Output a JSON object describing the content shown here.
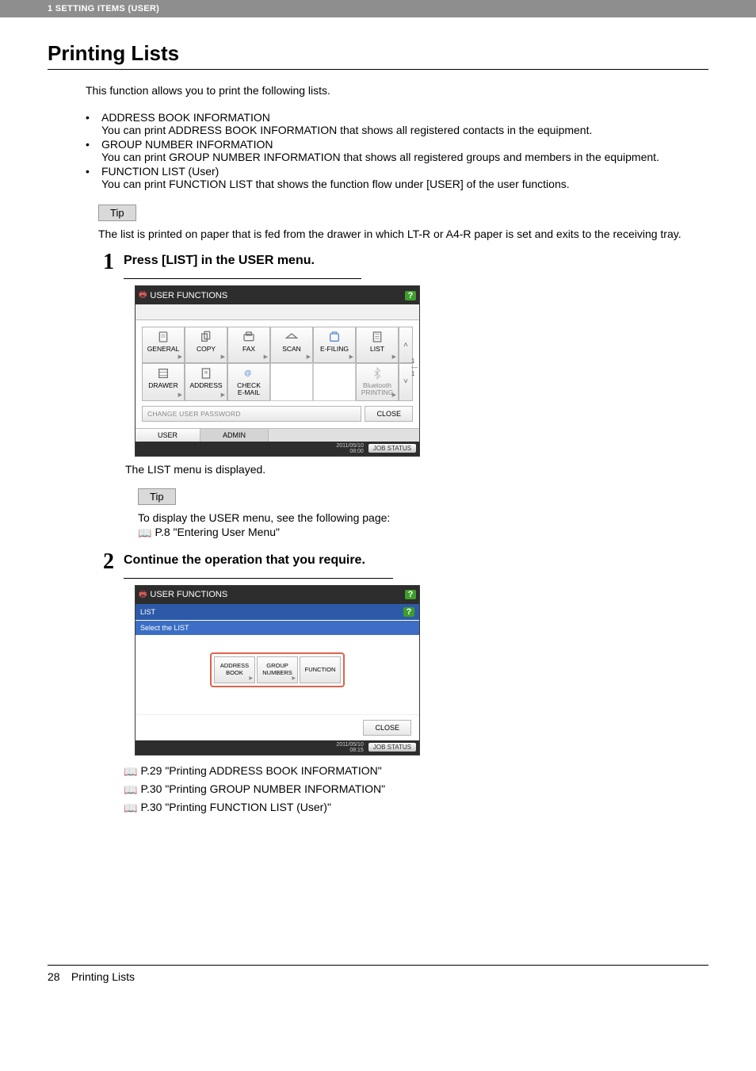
{
  "header": {
    "breadcrumb": "1 SETTING ITEMS (USER)"
  },
  "title": "Printing Lists",
  "intro": "This function allows you to print the following lists.",
  "bullets": [
    {
      "name": "ADDRESS BOOK INFORMATION",
      "desc": "You can print ADDRESS BOOK INFORMATION that shows all registered contacts in the equipment."
    },
    {
      "name": "GROUP NUMBER INFORMATION",
      "desc": "You can print GROUP NUMBER INFORMATION that shows all registered groups and members in the equipment."
    },
    {
      "name": "FUNCTION LIST (User)",
      "desc": "You can print FUNCTION LIST that shows the function flow under [USER] of the user functions."
    }
  ],
  "tip_label": "Tip",
  "tip1_text": "The list is printed on paper that is fed from the drawer in which LT-R or A4-R paper is set and exits to the receiving tray.",
  "step1": {
    "num": "1",
    "title": "Press [LIST] in the USER menu.",
    "after_text": "The LIST menu is displayed."
  },
  "panel1": {
    "title": "USER FUNCTIONS",
    "icons_row1": [
      "GENERAL",
      "COPY",
      "FAX",
      "SCAN",
      "E-FILING",
      "LIST"
    ],
    "icons_row2": [
      "DRAWER",
      "ADDRESS",
      "CHECK\nE-MAIL",
      "",
      "",
      "Bluetooth\nPRINTING"
    ],
    "change_pw": "CHANGE USER PASSWORD",
    "close": "CLOSE",
    "tabs": [
      "USER",
      "ADMIN"
    ],
    "datetime1": "2011/05/10",
    "datetime2": "08:00",
    "jobstatus": "JOB STATUS",
    "page_ind_num": "1",
    "page_ind_den": "1"
  },
  "tip2": {
    "text": "To display the USER menu, see the following page:",
    "ref": "P.8 \"Entering User Menu\""
  },
  "step2": {
    "num": "2",
    "title": "Continue the operation that you require."
  },
  "panel2": {
    "title": "USER FUNCTIONS",
    "sub1": "LIST",
    "sub2": "Select the LIST",
    "buttons": [
      {
        "l1": "ADDRESS",
        "l2": "BOOK"
      },
      {
        "l1": "GROUP",
        "l2": "NUMBERS"
      },
      {
        "l1": "FUNCTION",
        "l2": ""
      }
    ],
    "close": "CLOSE",
    "datetime1": "2011/05/10",
    "datetime2": "08:15",
    "jobstatus": "JOB STATUS"
  },
  "refs": [
    "P.29 \"Printing ADDRESS BOOK INFORMATION\"",
    "P.30 \"Printing GROUP NUMBER INFORMATION\"",
    "P.30 \"Printing FUNCTION LIST (User)\""
  ],
  "footer": {
    "page": "28",
    "title": "Printing Lists"
  }
}
